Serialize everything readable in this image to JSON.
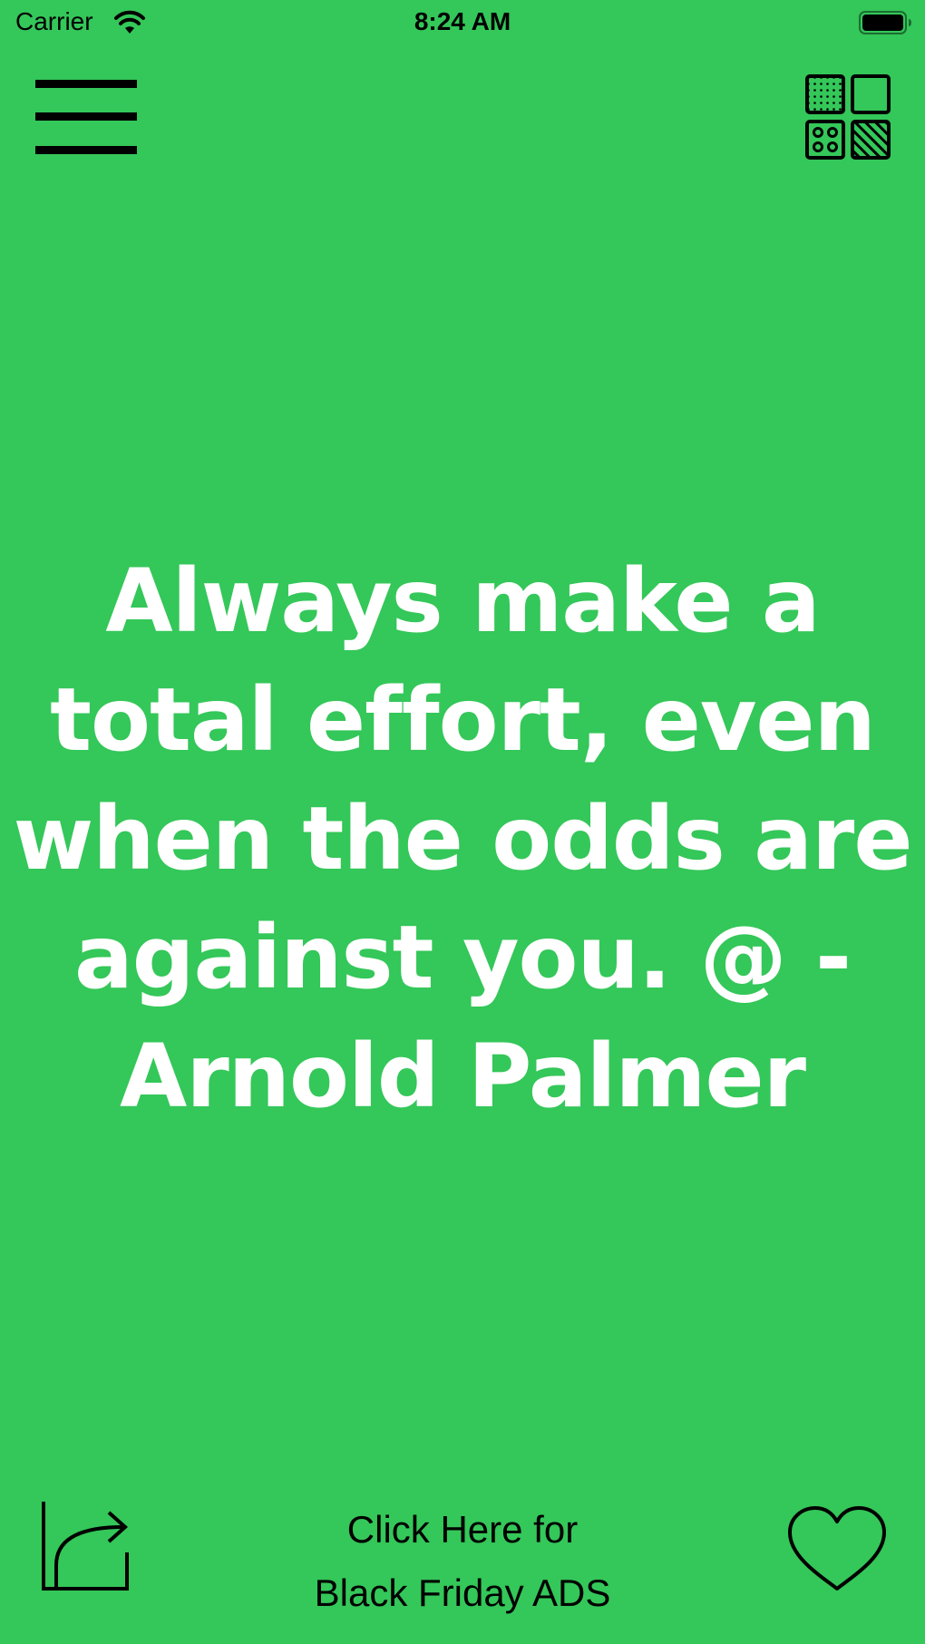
{
  "status_bar": {
    "carrier": "Carrier",
    "time": "8:24 AM",
    "icons": [
      "wifi-icon",
      "battery-icon"
    ]
  },
  "toolbar": {
    "menu_icon": "hamburger-menu-icon",
    "layout_icon": "grid-patterns-icon"
  },
  "quote": {
    "text": "Always make a total effort, even when the odds are against you. @ -Arnold Palmer"
  },
  "bottom_bar": {
    "share_icon": "share-arrow-icon",
    "ad_line1": "Click Here for",
    "ad_line2": "Black Friday ADS",
    "favorite_icon": "heart-outline-icon"
  },
  "colors": {
    "background": "#34C759",
    "quote_text": "#FFFFFF",
    "icons": "#000000"
  }
}
